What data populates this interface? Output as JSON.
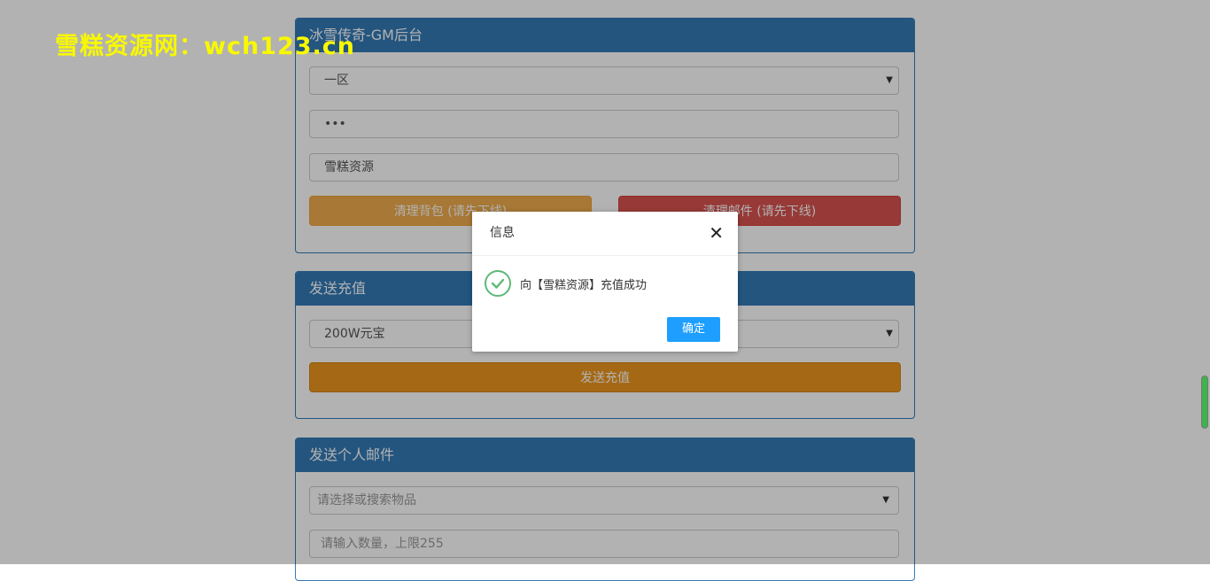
{
  "watermark": "雪糕资源网：wch123.cn",
  "panels": {
    "gm": {
      "title": "冰雪传奇-GM后台",
      "server_select": "一区",
      "password": "•••",
      "character": "雪糕资源",
      "clear_bag_btn": "清理背包 (请先下线)",
      "clear_mail_btn": "清理邮件 (请先下线)"
    },
    "recharge": {
      "title": "发送充值",
      "amount_select": "200W元宝",
      "send_btn": "发送充值"
    },
    "mail": {
      "title": "发送个人邮件",
      "item_placeholder": "请选择或搜索物品",
      "qty_placeholder": "请输入数量，上限255"
    }
  },
  "dialog": {
    "title": "信息",
    "message": "向【雪糕资源】充值成功",
    "confirm": "确定"
  },
  "colors": {
    "primary": "#337ab7",
    "warning": "#f0ad4e",
    "danger": "#d9534f",
    "recharge_btn": "#ec971f",
    "dialog_btn": "#1e9fff",
    "watermark": "#f8f800"
  },
  "icons": {
    "success": "check-circle-icon",
    "close": "close-icon",
    "caret": "caret-down-icon"
  }
}
